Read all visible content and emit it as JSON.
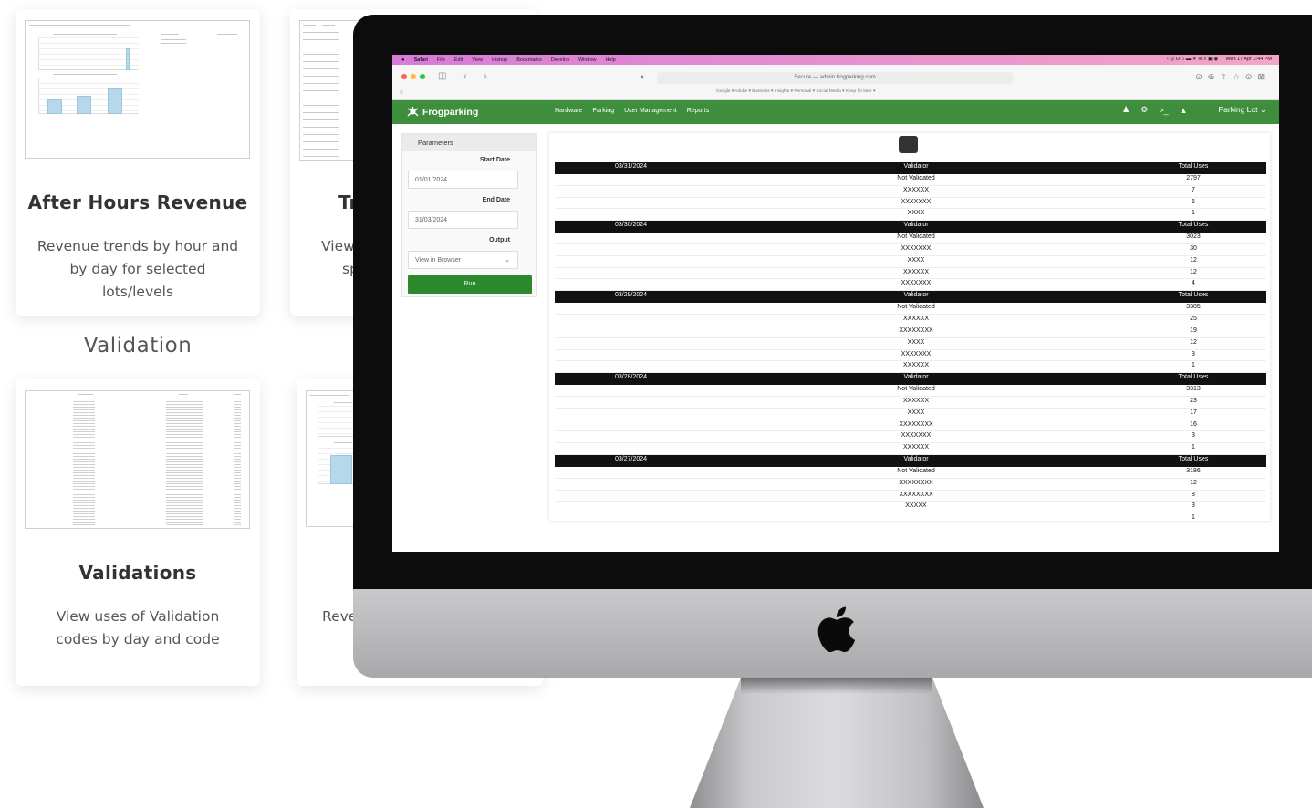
{
  "cards": {
    "after_hours": {
      "title": "After Hours Revenue",
      "description": "Revenue trends by hour and by day for selected lots/levels"
    },
    "section": "Validation",
    "validations": {
      "title": "Validations",
      "description": "View uses of Validation codes by day and code"
    },
    "partial_top": {
      "title_fragment": "Tr",
      "desc_line1": "View",
      "desc_line2": "sp"
    },
    "partial_bottom": {
      "desc_fragment": "Reve"
    }
  },
  "screen": {
    "menubar": {
      "app": "Safari",
      "items": [
        "File",
        "Edit",
        "View",
        "History",
        "Bookmarks",
        "Develop",
        "Window",
        "Help"
      ],
      "clock": "Wed 17 Apr 3:44 PM"
    },
    "browser": {
      "url": "Secure — admin.frogparking.com",
      "bookmarks": "Google ▾   Adobe ▾   Business ▾   Insights ▾   Personal ▾   Social Media ▾   Keep for later ▾"
    },
    "nav": {
      "brand": "Frogparking",
      "links": [
        "Hardware",
        "Parking",
        "User Management",
        "Reports"
      ],
      "lot_selector": "Parking Lot"
    },
    "parameters": {
      "title": "Parameters",
      "start_label": "Start Date",
      "start_value": "01/01/2024",
      "end_label": "End Date",
      "end_value": "31/03/2024",
      "output_label": "Output",
      "output_value": "View in Browser",
      "run_label": "Run"
    },
    "report": {
      "columns": [
        "Validator",
        "Total Uses"
      ],
      "groups": [
        {
          "date": "03/31/2024",
          "rows": [
            [
              "Not Validated",
              "2797"
            ],
            [
              "XXXXXX",
              "7"
            ],
            [
              "XXXXXXX",
              "6"
            ],
            [
              "XXXX",
              "1"
            ]
          ]
        },
        {
          "date": "03/30/2024",
          "rows": [
            [
              "Not Validated",
              "3023"
            ],
            [
              "XXXXXXX",
              "30"
            ],
            [
              "XXXX",
              "12"
            ],
            [
              "XXXXXX",
              "12"
            ],
            [
              "XXXXXXX",
              "4"
            ]
          ]
        },
        {
          "date": "03/29/2024",
          "rows": [
            [
              "Not Validated",
              "3385"
            ],
            [
              "XXXXXX",
              "25"
            ],
            [
              "XXXXXXXX",
              "19"
            ],
            [
              "XXXX",
              "12"
            ],
            [
              "XXXXXXX",
              "3"
            ],
            [
              "XXXXXX",
              "1"
            ]
          ]
        },
        {
          "date": "03/28/2024",
          "rows": [
            [
              "Not Validated",
              "3313"
            ],
            [
              "XXXXXX",
              "23"
            ],
            [
              "XXXX",
              "17"
            ],
            [
              "XXXXXXXX",
              "16"
            ],
            [
              "XXXXXXX",
              "3"
            ],
            [
              "XXXXXX",
              "1"
            ]
          ]
        },
        {
          "date": "03/27/2024",
          "rows": [
            [
              "Not Validated",
              "3186"
            ],
            [
              "XXXXXXXX",
              "12"
            ],
            [
              "XXXXXXXX",
              "8"
            ],
            [
              "XXXXX",
              "3"
            ],
            [
              "",
              "1"
            ]
          ]
        }
      ]
    }
  },
  "colors": {
    "nav_green": "#3e8e3e",
    "run_green": "#2c8a2c",
    "menubar_pink": "#f3a6c6",
    "table_header": "#111111"
  }
}
